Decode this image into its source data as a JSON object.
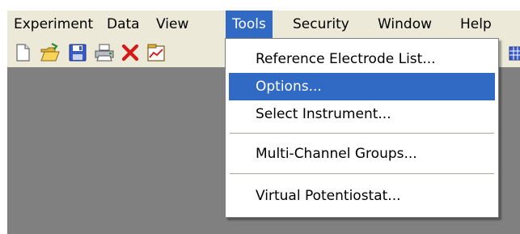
{
  "menubar": {
    "items": [
      {
        "label": "Experiment"
      },
      {
        "label": "Data"
      },
      {
        "label": "View"
      },
      {
        "label": "Tools",
        "active": true
      },
      {
        "label": "Security"
      },
      {
        "label": "Window"
      },
      {
        "label": "Help"
      }
    ]
  },
  "toolbar": {
    "buttons": [
      {
        "icon": "new-file-icon"
      },
      {
        "icon": "open-folder-icon"
      },
      {
        "icon": "save-icon"
      },
      {
        "icon": "print-icon"
      },
      {
        "icon": "delete-icon"
      },
      {
        "icon": "chart-icon"
      }
    ]
  },
  "tools_menu": {
    "items": [
      {
        "label": "Reference Electrode List..."
      },
      {
        "label": "Options...",
        "highlighted": true
      },
      {
        "label": "Select Instrument..."
      },
      {
        "label": "Multi-Channel Groups..."
      },
      {
        "label": "Virtual Potentiostat..."
      }
    ]
  },
  "colors": {
    "menubar_bg": "#ece9d8",
    "highlight": "#316ac5",
    "workspace_bg": "#808080"
  }
}
